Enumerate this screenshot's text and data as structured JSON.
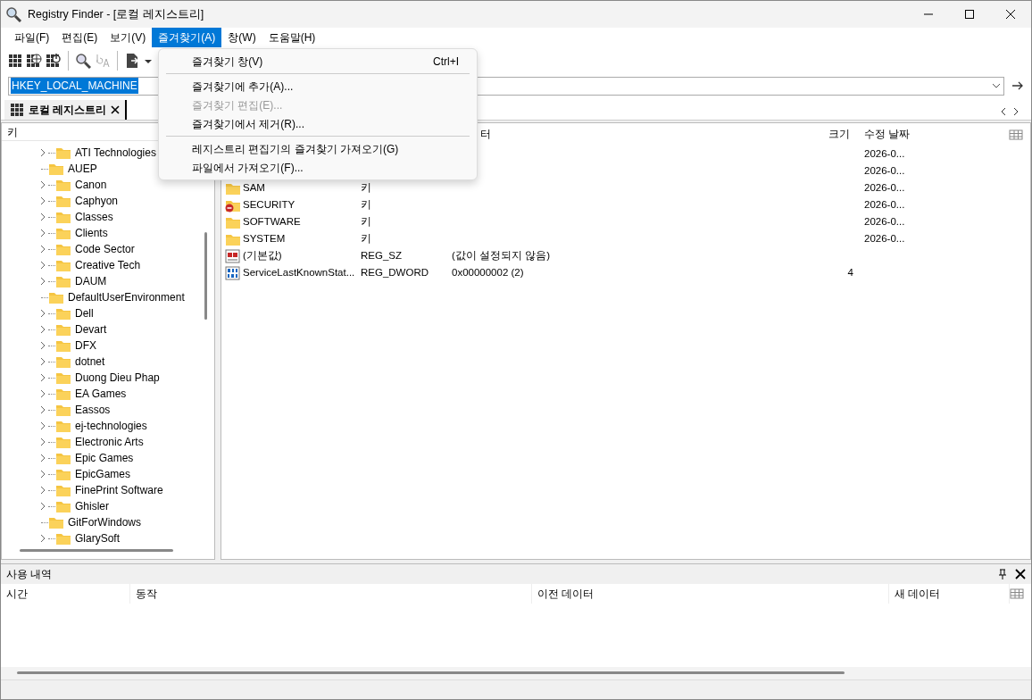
{
  "window": {
    "title": "Registry Finder - [로컬 레지스트리]"
  },
  "menu": [
    {
      "label": "파일(F)",
      "selected": false
    },
    {
      "label": "편집(E)",
      "selected": false
    },
    {
      "label": "보기(V)",
      "selected": false
    },
    {
      "label": "즐겨찾기(A)",
      "selected": true
    },
    {
      "label": "창(W)",
      "selected": false
    },
    {
      "label": "도움말(H)",
      "selected": false
    }
  ],
  "dropdown": [
    {
      "kind": "item",
      "label": "즐겨찾기 창(V)",
      "shortcut": "Ctrl+I",
      "disabled": false
    },
    {
      "kind": "separator"
    },
    {
      "kind": "item",
      "label": "즐겨찾기에 추가(A)...",
      "disabled": false
    },
    {
      "kind": "item",
      "label": "즐겨찾기 편집(E)...",
      "disabled": true
    },
    {
      "kind": "item",
      "label": "즐겨찾기에서 제거(R)...",
      "disabled": false
    },
    {
      "kind": "separator"
    },
    {
      "kind": "item",
      "label": "레지스트리 편집기의 즐겨찾기 가져오기(G)",
      "disabled": false
    },
    {
      "kind": "item",
      "label": "파일에서 가져오기(F)...",
      "disabled": false
    }
  ],
  "address": {
    "value": "HKEY_LOCAL_MACHINE"
  },
  "tabs": [
    {
      "label": "로컬 레지스트리",
      "selected": true
    }
  ],
  "tree": {
    "header": "키",
    "items": [
      {
        "label": "ATI Technologies",
        "expandable": true
      },
      {
        "label": "AUEP",
        "expandable": false
      },
      {
        "label": "Canon",
        "expandable": true
      },
      {
        "label": "Caphyon",
        "expandable": true
      },
      {
        "label": "Classes",
        "expandable": true
      },
      {
        "label": "Clients",
        "expandable": true
      },
      {
        "label": "Code Sector",
        "expandable": true
      },
      {
        "label": "Creative Tech",
        "expandable": true
      },
      {
        "label": "DAUM",
        "expandable": true
      },
      {
        "label": "DefaultUserEnvironment",
        "expandable": false
      },
      {
        "label": "Dell",
        "expandable": true
      },
      {
        "label": "Devart",
        "expandable": true
      },
      {
        "label": "DFX",
        "expandable": true
      },
      {
        "label": "dotnet",
        "expandable": true
      },
      {
        "label": "Duong Dieu Phap",
        "expandable": true
      },
      {
        "label": "EA Games",
        "expandable": true
      },
      {
        "label": "Eassos",
        "expandable": true
      },
      {
        "label": "ej-technologies",
        "expandable": true
      },
      {
        "label": "Electronic Arts",
        "expandable": true
      },
      {
        "label": "Epic Games",
        "expandable": true
      },
      {
        "label": "EpicGames",
        "expandable": true
      },
      {
        "label": "FinePrint Software",
        "expandable": true
      },
      {
        "label": "Ghisler",
        "expandable": true
      },
      {
        "label": "GitForWindows",
        "expandable": false
      },
      {
        "label": "GlarySoft",
        "expandable": true
      }
    ]
  },
  "list": {
    "columns": [
      "터",
      "크기",
      "수정 날짜"
    ],
    "rows": [
      {
        "kind": "hidden",
        "date": "2026-0..."
      },
      {
        "kind": "hidden",
        "date": "2026-0..."
      },
      {
        "kind": "key",
        "name": "SAM",
        "type": "키",
        "date": "2026-0..."
      },
      {
        "kind": "locked-key",
        "name": "SECURITY",
        "type": "키",
        "date": "2026-0..."
      },
      {
        "kind": "key",
        "name": "SOFTWARE",
        "type": "키",
        "date": "2026-0..."
      },
      {
        "kind": "key",
        "name": "SYSTEM",
        "type": "키",
        "date": "2026-0..."
      },
      {
        "kind": "string",
        "name": "(기본값)",
        "type": "REG_SZ",
        "data": "(값이 설정되지 않음)"
      },
      {
        "kind": "binary",
        "name": "ServiceLastKnownStat...",
        "type": "REG_DWORD",
        "data": "0x00000002 (2)",
        "size": "4"
      }
    ]
  },
  "history": {
    "title": "사용 내역",
    "columns": [
      "시간",
      "동작",
      "이전 데이터",
      "새 데이터"
    ]
  }
}
